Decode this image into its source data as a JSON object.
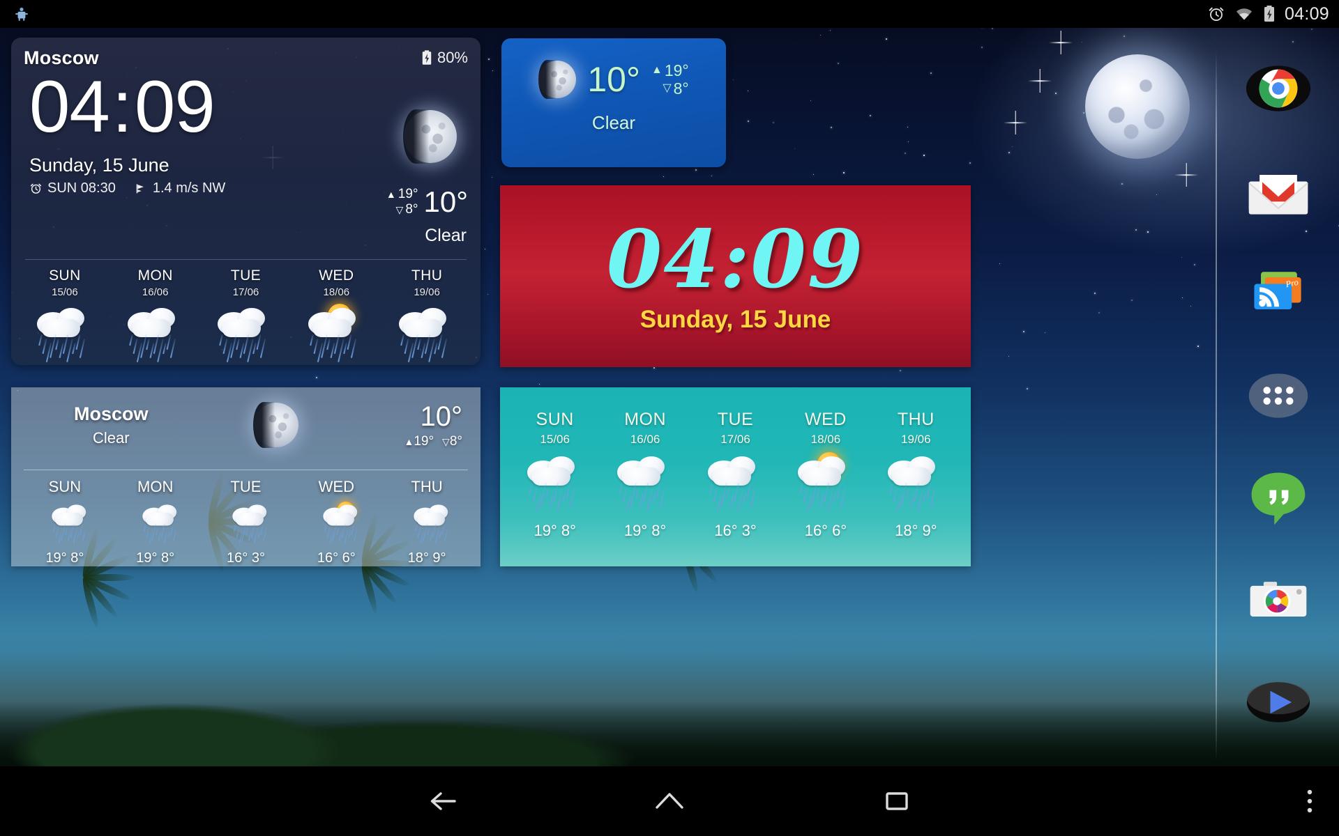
{
  "statusbar": {
    "time": "04:09",
    "icons": [
      "notification-icon",
      "alarm-icon",
      "wifi-icon",
      "battery-charging-icon"
    ]
  },
  "widgets": {
    "main_clock_weather": {
      "city": "Moscow",
      "battery": "80%",
      "hour": "04",
      "colon": ":",
      "minute": "09",
      "date": "Sunday, 15 June",
      "alarm": "SUN 08:30",
      "wind": "1.4 m/s NW",
      "high": "19°",
      "low": "8°",
      "current_temp": "10°",
      "condition": "Clear",
      "moon_phase": "waning-gibbous",
      "forecast": [
        {
          "day": "SUN",
          "date": "15/06",
          "icon": "rain-icon",
          "hi": "19°",
          "lo": "8°"
        },
        {
          "day": "MON",
          "date": "16/06",
          "icon": "rain-icon",
          "hi": "19°",
          "lo": "8°"
        },
        {
          "day": "TUE",
          "date": "17/06",
          "icon": "rain-icon",
          "hi": "16°",
          "lo": "3°"
        },
        {
          "day": "WED",
          "date": "18/06",
          "icon": "sun-rain-icon",
          "hi": "16°",
          "lo": "6°"
        },
        {
          "day": "THU",
          "date": "19/06",
          "icon": "rain-icon",
          "hi": "18°",
          "lo": "9°"
        }
      ]
    },
    "blue_weather": {
      "current_temp": "10°",
      "high": "19°",
      "low": "8°",
      "condition": "Clear",
      "moon_phase": "waning-gibbous",
      "background_color": "#0f55b2",
      "text_color": "#c6f5c8"
    },
    "red_clock": {
      "time": "04:09",
      "date": "Sunday, 15 June",
      "background_color": "#ba1a2c",
      "time_color": "#6ff5f3",
      "date_color": "#ffd740"
    },
    "grey_weather": {
      "city": "Moscow",
      "condition": "Clear",
      "current_temp": "10°",
      "high": "19°",
      "low": "8°",
      "moon_phase": "waning-gibbous",
      "forecast": [
        {
          "day": "SUN",
          "icon": "rain-icon",
          "hi": "19°",
          "lo": "8°"
        },
        {
          "day": "MON",
          "icon": "rain-icon",
          "hi": "19°",
          "lo": "8°"
        },
        {
          "day": "TUE",
          "icon": "rain-icon",
          "hi": "16°",
          "lo": "3°"
        },
        {
          "day": "WED",
          "icon": "sun-rain-icon",
          "hi": "16°",
          "lo": "6°"
        },
        {
          "day": "THU",
          "icon": "rain-icon",
          "hi": "18°",
          "lo": "9°"
        }
      ]
    },
    "teal_forecast": {
      "background_color": "#20b7b6",
      "forecast": [
        {
          "day": "SUN",
          "date": "15/06",
          "icon": "rain-icon",
          "hi": "19°",
          "lo": "8°"
        },
        {
          "day": "MON",
          "date": "16/06",
          "icon": "rain-icon",
          "hi": "19°",
          "lo": "8°"
        },
        {
          "day": "TUE",
          "date": "17/06",
          "icon": "rain-icon",
          "hi": "16°",
          "lo": "3°"
        },
        {
          "day": "WED",
          "date": "18/06",
          "icon": "sun-rain-icon",
          "hi": "16°",
          "lo": "6°"
        },
        {
          "day": "THU",
          "date": "19/06",
          "icon": "rain-icon",
          "hi": "18°",
          "lo": "9°"
        }
      ]
    }
  },
  "dock": {
    "items": [
      {
        "name": "chrome-icon",
        "label": "Chrome"
      },
      {
        "name": "gmail-icon",
        "label": "Gmail"
      },
      {
        "name": "rss-reader-pro-icon",
        "label": "Pro"
      },
      {
        "name": "app-drawer-icon",
        "label": "Apps"
      },
      {
        "name": "hangouts-icon",
        "label": "Hangouts"
      },
      {
        "name": "camera-photos-icon",
        "label": "Camera"
      },
      {
        "name": "play-video-icon",
        "label": "Play"
      }
    ]
  },
  "navbar": {
    "buttons": [
      "back-button",
      "home-button",
      "recents-button",
      "overflow-menu-button"
    ]
  }
}
